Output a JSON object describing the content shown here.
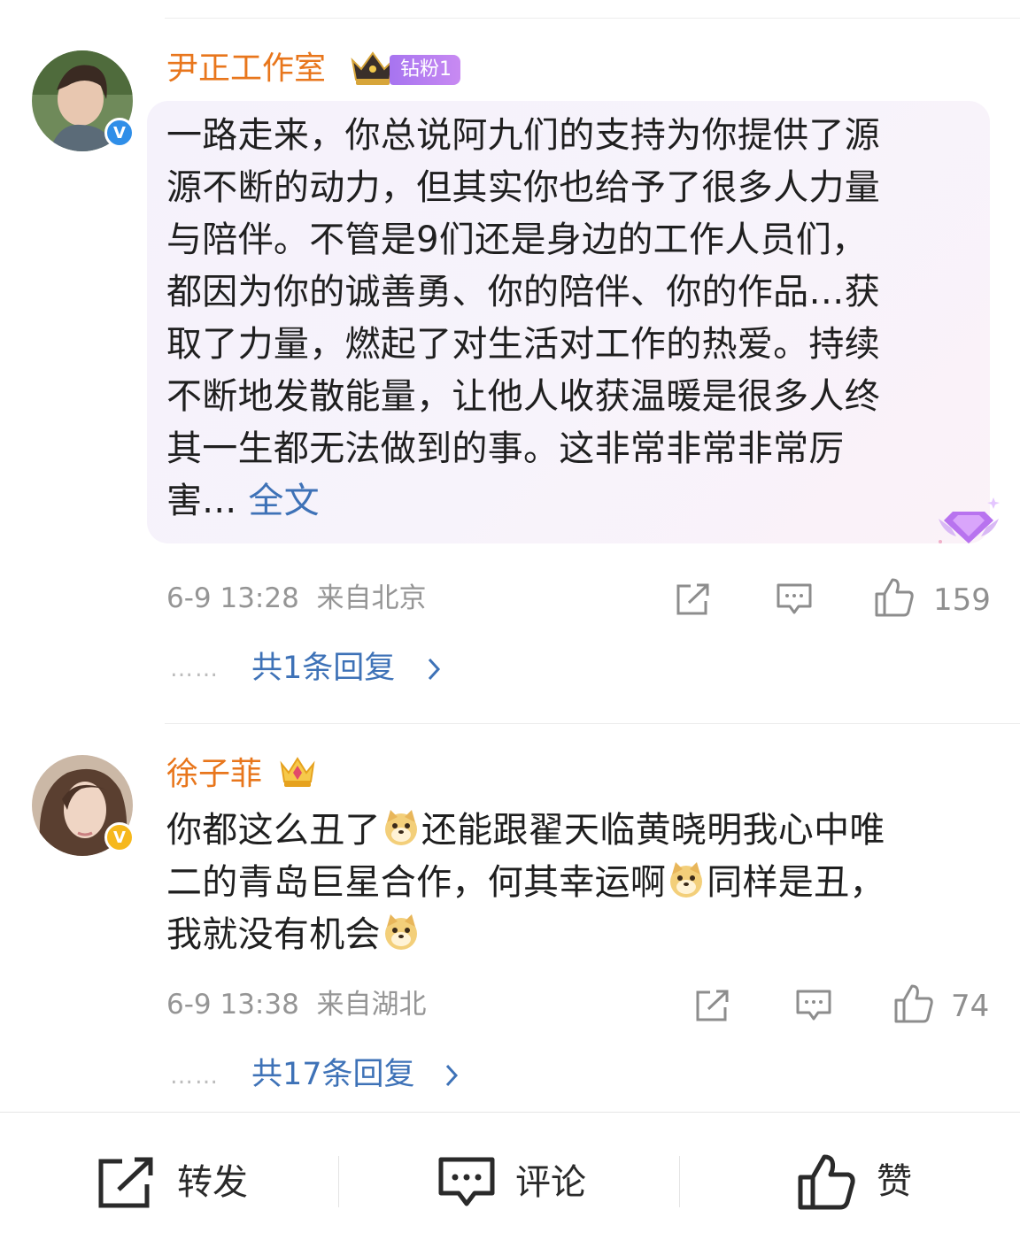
{
  "comments": [
    {
      "username": "尹正工作室",
      "fan_badge": "钻粉1",
      "verified": "V",
      "lines": [
        "一路走来，你总说阿九们的支持为你提供了源",
        "源不断的动力，但其实你也给予了很多人力量",
        "与陪伴。不管是9们还是身边的工作人员们，",
        "都因为你的诚善勇、你的陪伴、你的作品…获",
        "取了力量，燃起了对生活对工作的热爱。持续",
        "不断地发散能量，让他人收获温暖是很多人终",
        "其一生都无法做到的事。这非常非常非常厉",
        "害..."
      ],
      "more": "全文",
      "time": "6-9 13:28",
      "location": "来自北京",
      "likes": "159",
      "reply_dots": "……",
      "replies": "共1条回复"
    },
    {
      "username": "徐子菲",
      "verified": "V",
      "lines": [
        "你都这么丑了",
        "还能跟翟天临黄晓明我心中唯",
        "二的青岛巨星合作，何其幸运啊",
        "同样是丑，",
        "我就没有机会"
      ],
      "time": "6-9 13:38",
      "location": "来自湖北",
      "likes": "74",
      "reply_dots": "……",
      "replies": "共17条回复"
    }
  ],
  "toolbar": {
    "repost": "转发",
    "comment": "评论",
    "like": "赞"
  },
  "colors": {
    "username": "#e8761c",
    "link": "#3e72b7",
    "meta": "#959595",
    "fan_badge": "#b47cf0"
  },
  "icons": [
    "share-icon",
    "comment-icon",
    "like-icon",
    "verified-icon",
    "crown-icon",
    "doge-emoji-icon",
    "diamond-fan-icon",
    "chevron-right-icon"
  ]
}
